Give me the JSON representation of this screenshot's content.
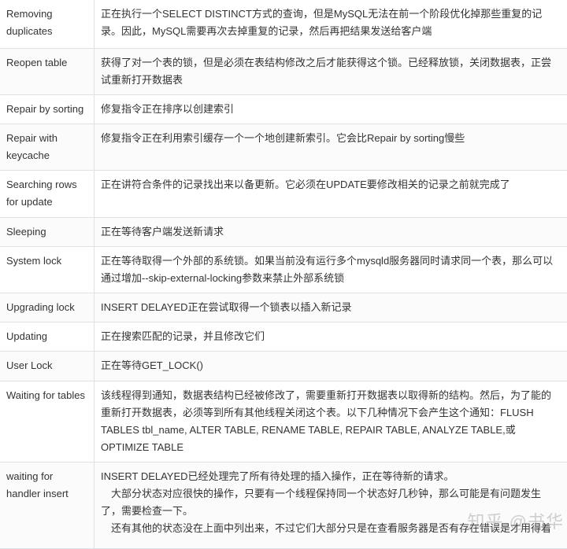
{
  "rows": [
    {
      "state": "Removing duplicates",
      "desc": [
        "正在执行一个SELECT DISTINCT方式的查询，但是MySQL无法在前一个阶段优化掉那些重复的记录。因此，MySQL需要再次去掉重复的记录，然后再把结果发送给客户端"
      ]
    },
    {
      "state": "Reopen table",
      "desc": [
        "获得了对一个表的锁，但是必须在表结构修改之后才能获得这个锁。已经释放锁，关闭数据表，正尝试重新打开数据表"
      ]
    },
    {
      "state": "Repair by sorting",
      "desc": [
        "修复指令正在排序以创建索引"
      ]
    },
    {
      "state": "Repair with keycache",
      "desc": [
        "修复指令正在利用索引缓存一个一个地创建新索引。它会比Repair by sorting慢些"
      ]
    },
    {
      "state": "Searching rows for update",
      "desc": [
        "正在讲符合条件的记录找出来以备更新。它必须在UPDATE要修改相关的记录之前就完成了"
      ]
    },
    {
      "state": "Sleeping",
      "desc": [
        "正在等待客户端发送新请求"
      ]
    },
    {
      "state": "System lock",
      "desc": [
        "正在等待取得一个外部的系统锁。如果当前没有运行多个mysqld服务器同时请求同一个表，那么可以通过增加--skip-external-locking参数来禁止外部系统锁"
      ]
    },
    {
      "state": "Upgrading lock",
      "desc": [
        "INSERT DELAYED正在尝试取得一个锁表以插入新记录"
      ]
    },
    {
      "state": "Updating",
      "desc": [
        "正在搜索匹配的记录，并且修改它们"
      ]
    },
    {
      "state": "User Lock",
      "desc": [
        "正在等待GET_LOCK()"
      ]
    },
    {
      "state": "Waiting for tables",
      "desc": [
        "该线程得到通知，数据表结构已经被修改了，需要重新打开数据表以取得新的结构。然后，为了能的重新打开数据表，必须等到所有其他线程关闭这个表。以下几种情况下会产生这个通知：FLUSH TABLES tbl_name, ALTER TABLE, RENAME TABLE, REPAIR TABLE, ANALYZE TABLE,或OPTIMIZE TABLE"
      ]
    },
    {
      "state": "waiting for handler insert",
      "desc": [
        "INSERT DELAYED已经处理完了所有待处理的插入操作，正在等待新的请求。",
        "　大部分状态对应很快的操作，只要有一个线程保持同一个状态好几秒钟，那么可能是有问题发生了，需要检查一下。",
        "　还有其他的状态没在上面中列出来，不过它们大部分只是在查看服务器是否有存在错误是才用得着"
      ]
    }
  ],
  "watermark": "知乎 @书华"
}
